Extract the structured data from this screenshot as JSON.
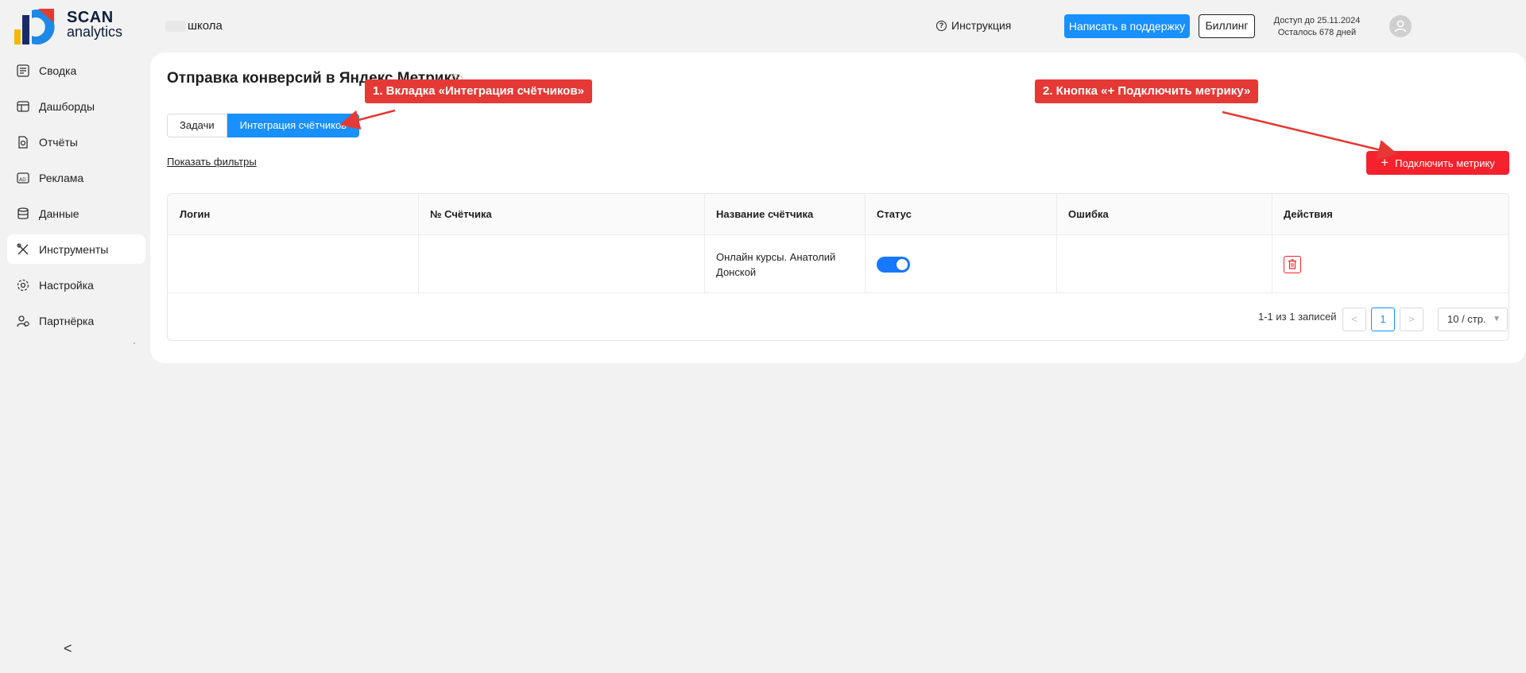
{
  "header": {
    "logo_scan": "SCAN",
    "logo_analytics": "analytics",
    "project_name": "школа",
    "instruction_label": "Инструкция",
    "support_button": "Написать в поддержку",
    "billing_button": "Биллинг",
    "access_until": "Доступ до 25.11.2024",
    "days_left": "Осталось 678 дней"
  },
  "sidebar": {
    "items": [
      {
        "label": "Сводка",
        "icon": "summary-icon"
      },
      {
        "label": "Дашборды",
        "icon": "dashboard-icon"
      },
      {
        "label": "Отчёты",
        "icon": "report-icon"
      },
      {
        "label": "Реклама",
        "icon": "ads-icon"
      },
      {
        "label": "Данные",
        "icon": "database-icon"
      },
      {
        "label": "Инструменты",
        "icon": "tools-icon",
        "active": true
      },
      {
        "label": "Настройка",
        "icon": "settings-icon"
      },
      {
        "label": "Партнёрка",
        "icon": "partner-icon"
      }
    ],
    "collapse_glyph": "<"
  },
  "main": {
    "title": "Отправка конверсий в Яндекс Метрику",
    "tabs": [
      {
        "label": "Задачи",
        "active": false
      },
      {
        "label": "Интеграция счётчиков",
        "active": true
      }
    ],
    "show_filters": "Показать фильтры",
    "connect_button": "Подключить метрику",
    "connect_plus": "+",
    "table": {
      "columns": [
        "Логин",
        "№ Счётчика",
        "Название счётчика",
        "Статус",
        "Ошибка",
        "Действия"
      ],
      "rows": [
        {
          "login": "",
          "counter_number": "",
          "counter_name": "Онлайн курсы. Анатолий Донской",
          "status_enabled": true,
          "error": ""
        }
      ]
    },
    "pagination": {
      "total": "1-1 из 1 записей",
      "prev": "<",
      "current": "1",
      "next": ">",
      "page_size": "10 / стр."
    }
  },
  "annotations": {
    "first": "1. Вкладка «Интеграция счётчиков»",
    "second": "2. Кнопка «+ Подключить метрику»"
  },
  "colors": {
    "primary": "#1890ff",
    "danger": "#f5222d",
    "annotation": "#e53935"
  }
}
